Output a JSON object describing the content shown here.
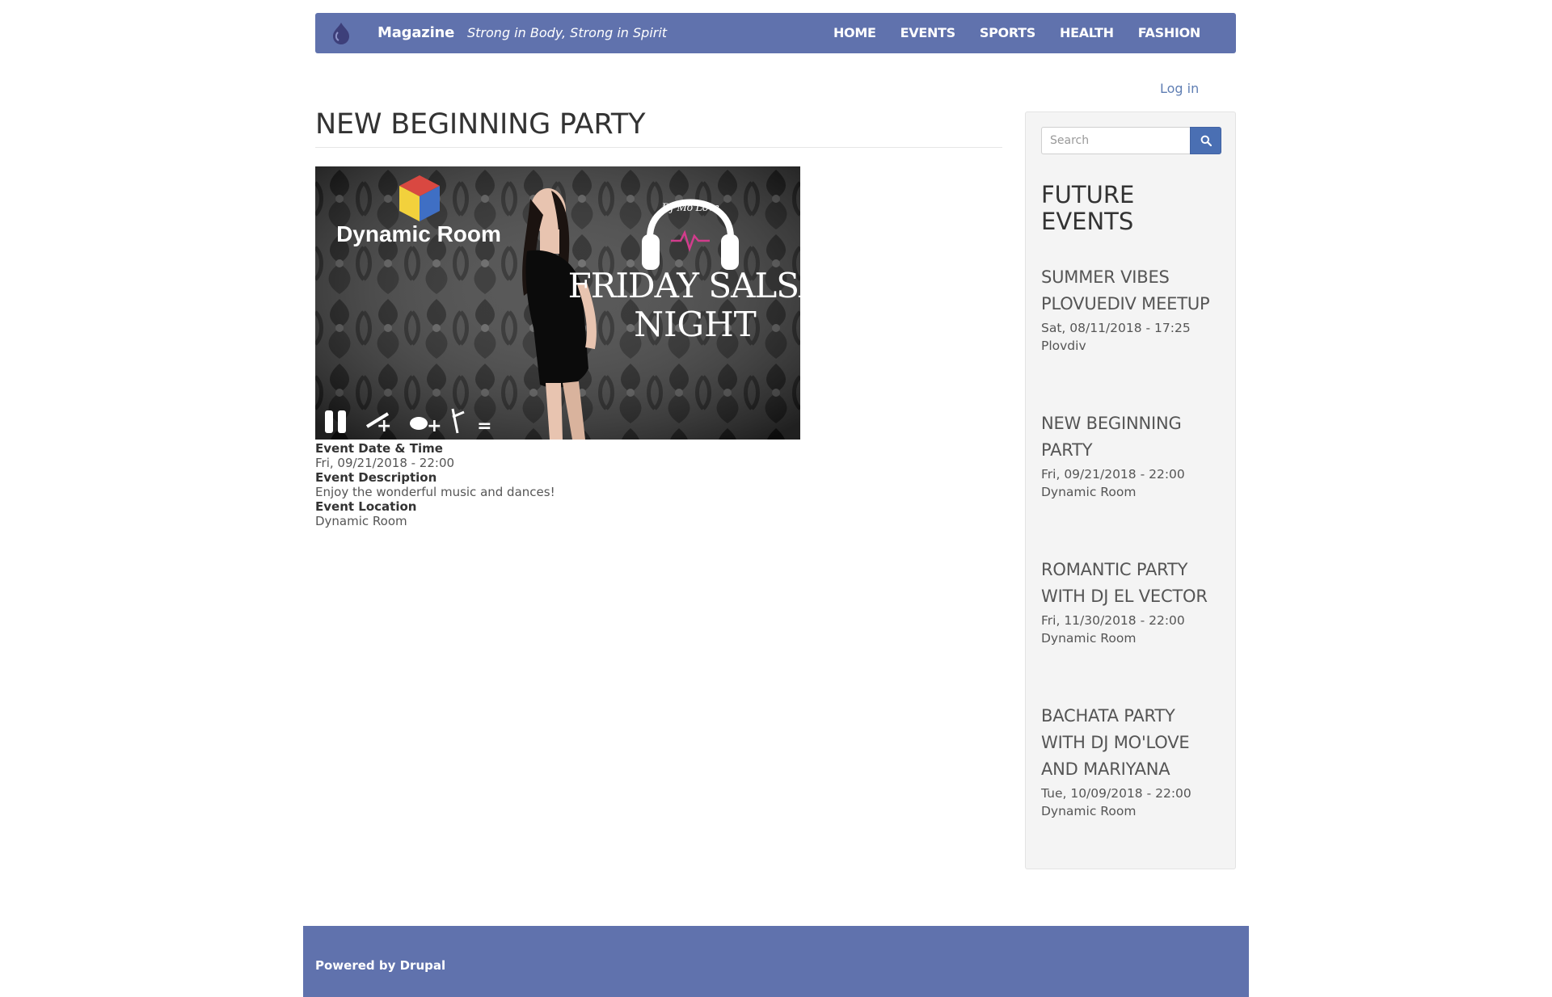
{
  "header": {
    "logo_icon": "drupal-drop-icon",
    "site_name": "Magazine",
    "slogan": "Strong in Body, Strong in Spirit",
    "nav": [
      "HOME",
      "EVENTS",
      "SPORTS",
      "HEALTH",
      "FASHION"
    ],
    "bar_color": "#6072ad"
  },
  "user": {
    "login_label": "Log in"
  },
  "main": {
    "title": "NEW BEGINNING PARTY",
    "image": {
      "venue_text": "Dynamic Room",
      "dj_text": "Dj Mo'Love",
      "line1": "FRIDAY SALSA",
      "line2": "NIGHT",
      "formula": "+ + ="
    },
    "fields": {
      "date_label": "Event Date & Time",
      "date_value": "Fri, 09/21/2018 - 22:00",
      "desc_label": "Event Description",
      "desc_value": "Enjoy the wonderful music and dances!",
      "loc_label": "Event Location",
      "loc_value": "Dynamic Room"
    }
  },
  "sidebar": {
    "search_placeholder": "Search",
    "search_icon": "search-icon",
    "block_title": "FUTURE EVENTS",
    "events": [
      {
        "title": "SUMMER VIBES PLOVUEDIV MEETUP",
        "date": "Sat, 08/11/2018 - 17:25",
        "location": "Plovdiv"
      },
      {
        "title": "NEW BEGINNING PARTY",
        "date": "Fri, 09/21/2018 - 22:00",
        "location": "Dynamic Room"
      },
      {
        "title": "ROMANTIC PARTY WITH DJ EL VECTOR",
        "date": "Fri, 11/30/2018 - 22:00",
        "location": "Dynamic Room"
      },
      {
        "title": "BACHATA PARTY WITH DJ MO'LOVE AND MARIYANA",
        "date": "Tue, 10/09/2018 - 22:00",
        "location": "Dynamic Room"
      }
    ]
  },
  "footer": {
    "text": "Powered by Drupal"
  }
}
